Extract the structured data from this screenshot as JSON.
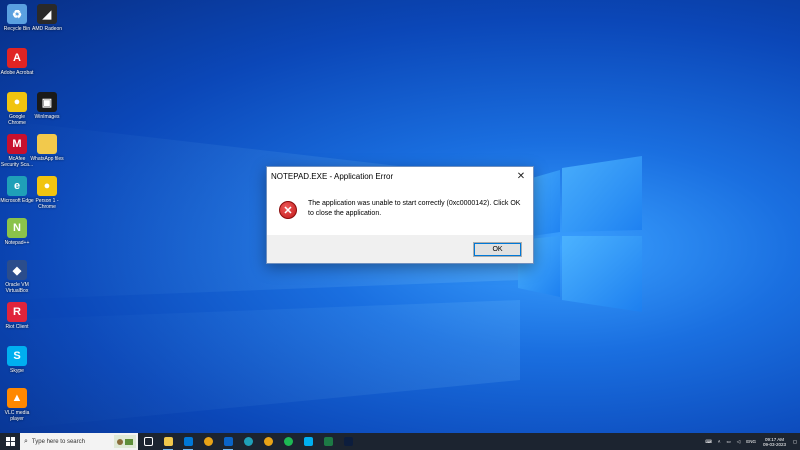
{
  "desktop": {
    "icons": [
      {
        "label": "Recycle Bin",
        "icon": "recycle-bin-icon",
        "color": "#5aa0e0",
        "glyph": "♻"
      },
      {
        "label": "AMD Radeon",
        "icon": "amd-radeon-icon",
        "color": "#2a2a2a",
        "glyph": "◢"
      },
      {
        "label": "Adobe Acrobat",
        "icon": "adobe-acrobat-icon",
        "color": "#e02424",
        "glyph": "A"
      },
      {
        "label": "Google Chrome",
        "icon": "chrome-icon",
        "color": "#f1c40f",
        "glyph": "●"
      },
      {
        "label": "WinImages",
        "icon": "winimages-icon",
        "color": "#1a1a1a",
        "glyph": "▣"
      },
      {
        "label": "McAfee Security Sca...",
        "icon": "mcafee-icon",
        "color": "#c8102e",
        "glyph": "M"
      },
      {
        "label": "WhatsApp files",
        "icon": "folder-icon",
        "color": "#f2c94c",
        "glyph": ""
      },
      {
        "label": "Microsoft Edge",
        "icon": "edge-icon",
        "color": "#1fa0b8",
        "glyph": "e"
      },
      {
        "label": "Person 1 - Chrome",
        "icon": "chrome-profile-icon",
        "color": "#f1c40f",
        "glyph": "●"
      },
      {
        "label": "Notepad++",
        "icon": "notepad-plus-plus-icon",
        "color": "#8bc34a",
        "glyph": "N"
      },
      {
        "label": "Oracle VM VirtualBox",
        "icon": "virtualbox-icon",
        "color": "#2b4d8c",
        "glyph": "◆"
      },
      {
        "label": "Riot Client",
        "icon": "riot-client-icon",
        "color": "#e0243b",
        "glyph": "R"
      },
      {
        "label": "Skype",
        "icon": "skype-icon",
        "color": "#00aff0",
        "glyph": "S"
      },
      {
        "label": "VLC media player",
        "icon": "vlc-icon",
        "color": "#ff8800",
        "glyph": "▲"
      }
    ]
  },
  "dialog": {
    "title": "NOTEPAD.EXE - Application Error",
    "close_glyph": "✕",
    "icon_glyph": "✕",
    "message": "The application was unable to start correctly (0xc0000142). Click OK to close the application.",
    "ok_label": "OK"
  },
  "taskbar": {
    "search_placeholder": "Type here to search",
    "pinned": [
      {
        "name": "task-view-icon",
        "color": "#ffffff"
      },
      {
        "name": "file-explorer-icon",
        "color": "#f2c94c"
      },
      {
        "name": "mail-icon",
        "color": "#0078d7"
      },
      {
        "name": "chrome-icon",
        "color": "#e8a317"
      },
      {
        "name": "outlook-icon",
        "color": "#0a64c8"
      },
      {
        "name": "edge-icon",
        "color": "#1fa0b8"
      },
      {
        "name": "chrome-icon",
        "color": "#e8a317"
      },
      {
        "name": "spotify-icon",
        "color": "#1db954"
      },
      {
        "name": "skype-icon",
        "color": "#00aff0"
      },
      {
        "name": "excel-icon",
        "color": "#1d7a45"
      },
      {
        "name": "photoshop-icon",
        "color": "#0c1d3d"
      }
    ],
    "language": "ENG",
    "time": "09:17 AM",
    "date": "09-03-2023"
  }
}
